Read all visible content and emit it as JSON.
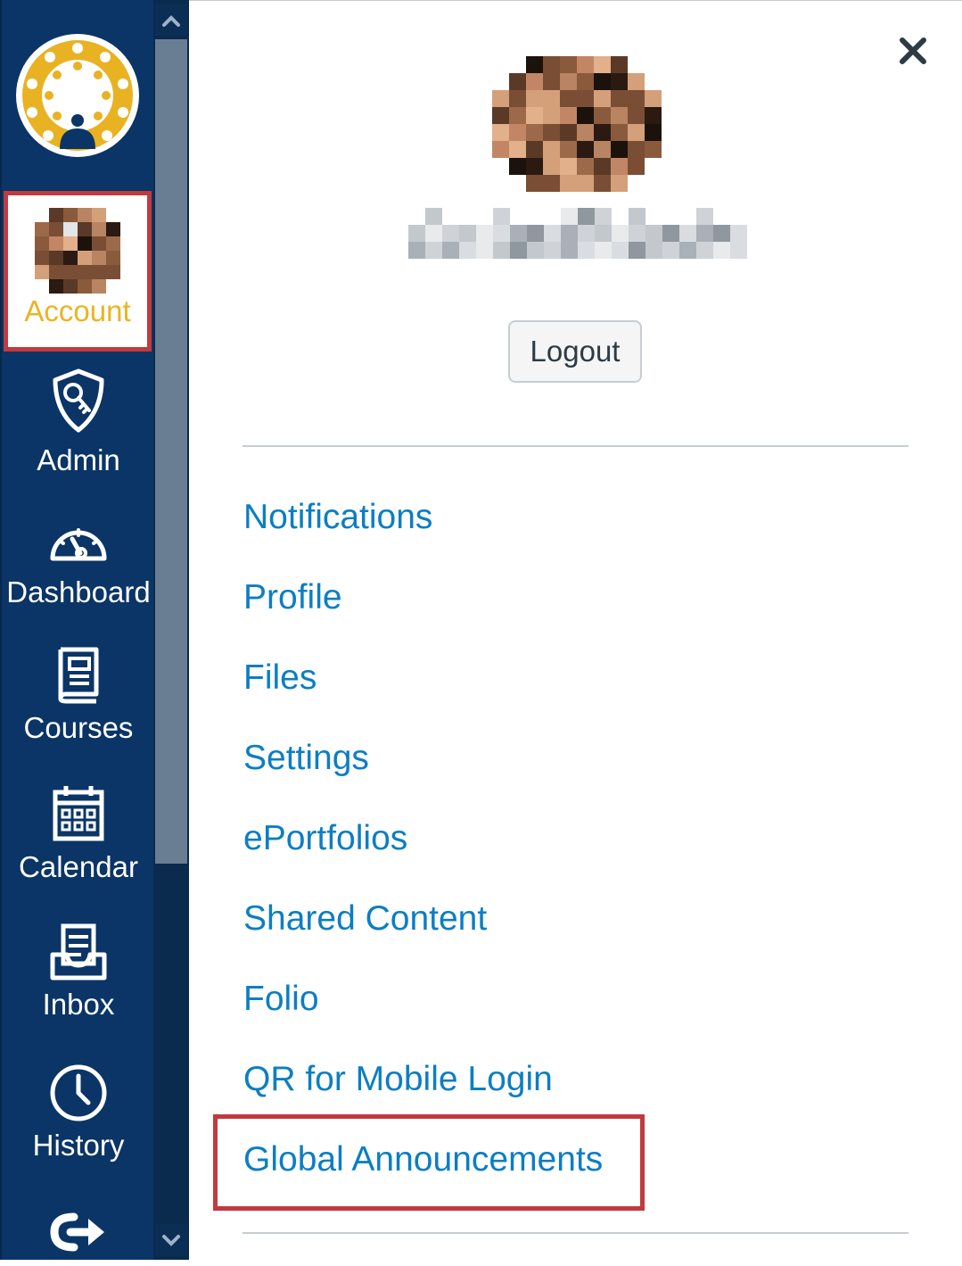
{
  "global_nav": {
    "items": [
      {
        "label": "Account",
        "icon": "user-avatar",
        "active": true
      },
      {
        "label": "Admin",
        "icon": "admin-shield-key-icon"
      },
      {
        "label": "Dashboard",
        "icon": "speedometer-icon"
      },
      {
        "label": "Courses",
        "icon": "book-icon"
      },
      {
        "label": "Calendar",
        "icon": "calendar-icon"
      },
      {
        "label": "Inbox",
        "icon": "inbox-icon"
      },
      {
        "label": "History",
        "icon": "clock-icon"
      }
    ]
  },
  "tray": {
    "logout_label": "Logout",
    "links": [
      {
        "label": "Notifications"
      },
      {
        "label": "Profile"
      },
      {
        "label": "Files"
      },
      {
        "label": "Settings"
      },
      {
        "label": "ePortfolios"
      },
      {
        "label": "Shared Content"
      },
      {
        "label": "Folio"
      },
      {
        "label": "QR for Mobile Login"
      },
      {
        "label": "Global Announcements",
        "highlighted": true
      }
    ]
  },
  "colors": {
    "nav_background": "#0a3566",
    "account_label": "#eab423",
    "link": "#0b7ec4",
    "highlight_border": "#c23a3f",
    "logo_yellow": "#e9b223"
  }
}
